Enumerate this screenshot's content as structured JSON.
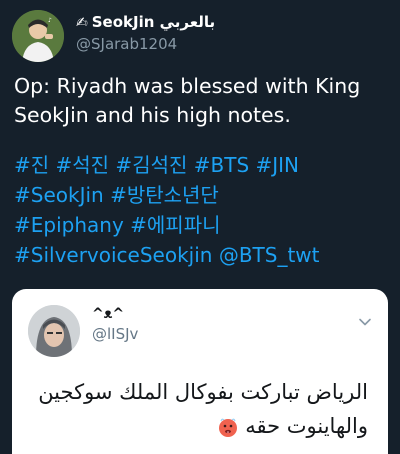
{
  "author": {
    "display_name": "SeokJin بالعربي",
    "hand_icon": "writing-hand-icon",
    "username": "@SJarab1204"
  },
  "tweet": {
    "text": "Op: Riyadh was blessed with King SeokJin and his high notes.",
    "hashtag_lines": [
      "#진 #석진 #김석진 #BTS #JIN",
      "#SeokJin #방탄소년단",
      "#Epiphany #에피파니",
      "#SilvervoiceSeokjin @BTS_twt"
    ]
  },
  "quoted_tweet": {
    "display_name": "^ᴥ^",
    "username": "@lISJv",
    "text_line1": "الرياض تباركت بفوكال الملك سوكجين",
    "text_line2": "والهاينوت حقه",
    "emoji": "hot-face-emoji"
  },
  "colors": {
    "background": "#15202b",
    "link": "#1da1f2",
    "secondary_text": "#8899a6"
  }
}
